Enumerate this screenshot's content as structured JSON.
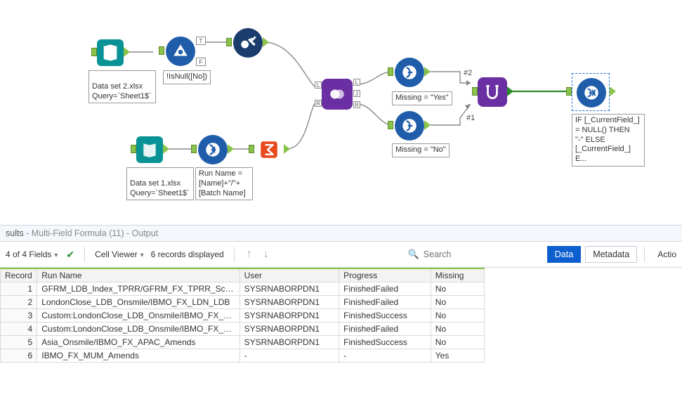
{
  "canvas": {
    "input2": {
      "file": "Data set 2.xlsx",
      "query": "Query=`Sheet1$`"
    },
    "input1": {
      "file": "Data set 1.xlsx",
      "query": "Query=`Sheet1$`"
    },
    "filter_expr": "!IsNull([No])",
    "formula1_expr": "Run Name =\n[Name]+\"/\"+\n[Batch Name]",
    "formula_missing_yes": "Missing = \"Yes\"",
    "formula_missing_no": "Missing = \"No\"",
    "mff_expr": "IF [_CurrentField_]\n= NULL() THEN\n\"-\" ELSE\n[_CurrentField_]\nE...",
    "hash1": "#1",
    "hash2": "#2",
    "ports": {
      "L": "L",
      "J": "J",
      "R": "R",
      "T": "T",
      "F": "F"
    }
  },
  "results": {
    "header_prefix": "sults",
    "header_title": " - Multi-Field Formula (11) - Output",
    "fields_label": "4 of 4 Fields",
    "cell_viewer": "Cell Viewer",
    "records_label": "6 records displayed",
    "search_placeholder": "Search",
    "tab_data": "Data",
    "tab_metadata": "Metadata",
    "actions_label": "Actio",
    "columns": {
      "record": "Record",
      "run": "Run Name",
      "user": "User",
      "progress": "Progress",
      "missing": "Missing"
    },
    "rows": [
      {
        "n": "1",
        "run": "GFRM_LDB_Index_TPRR/GFRM_FX_TPRR_Scenarios",
        "user": "SYSRNABORPDN1",
        "progress": "FinishedFailed",
        "missing": "No"
      },
      {
        "n": "2",
        "run": "LondonClose_LDB_Onsmile/IBMO_FX_LDN_LDB",
        "user": "SYSRNABORPDN1",
        "progress": "FinishedFailed",
        "missing": "No"
      },
      {
        "n": "3",
        "run": "Custom:LondonClose_LDB_Onsmile/IBMO_FX_LD...",
        "user": "SYSRNABORPDN1",
        "progress": "FinishedSuccess",
        "missing": "No"
      },
      {
        "n": "4",
        "run": "Custom:LondonClose_LDB_Onsmile/IBMO_FX_LD...",
        "user": "SYSRNABORPDN1",
        "progress": "FinishedFailed",
        "missing": "No"
      },
      {
        "n": "5",
        "run": "Asia_Onsmile/IBMO_FX_APAC_Amends",
        "user": "SYSRNABORPDN1",
        "progress": "FinishedSuccess",
        "missing": "No"
      },
      {
        "n": "6",
        "run": "IBMO_FX_MUM_Amends",
        "user": "-",
        "progress": "-",
        "missing": "Yes"
      }
    ]
  }
}
